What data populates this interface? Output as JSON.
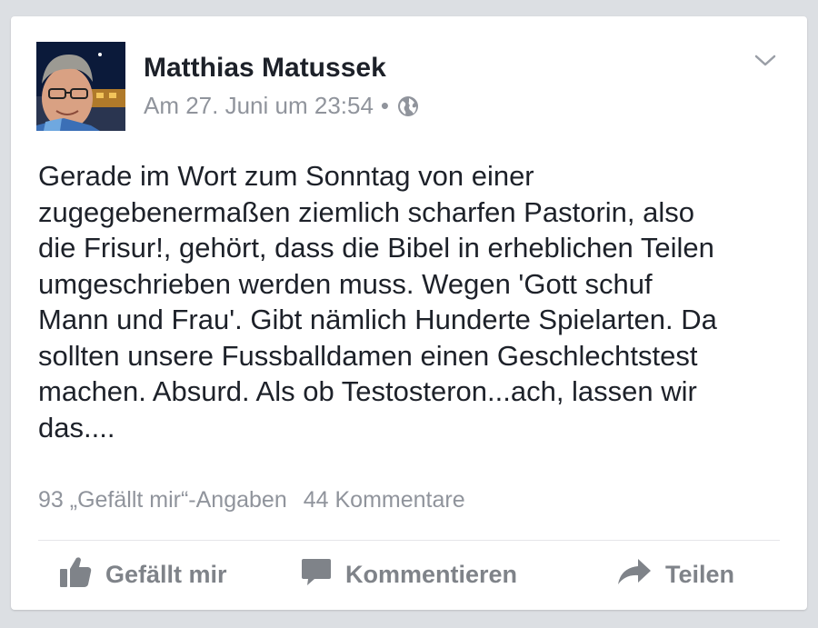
{
  "post": {
    "author": "Matthias Matussek",
    "timestamp": "Am 27. Juni um 23:54",
    "separator": "•",
    "privacy_icon": "globe-icon",
    "menu_icon": "chevron-down-icon",
    "text": "Gerade im Wort zum Sonntag von einer\nzugegebenermaßen ziemlich scharfen Pastorin, also\ndie Frisur!, gehört, dass die Bibel in erheblichen Teilen\numgeschrieben werden muss. Wegen 'Gott schuf\nMann und Frau'. Gibt nämlich Hunderte Spielarten. Da\nsollten unsere Fussballdamen einen Geschlechtstest\nmachen. Absurd. Als ob Testosteron...ach, lassen wir\ndas...."
  },
  "stats": {
    "likes": "93 „Gefällt mir“-Angaben",
    "comments": "44 Kommentare"
  },
  "actions": {
    "like_label": "Gefällt mir",
    "comment_label": "Kommentieren",
    "share_label": "Teilen"
  },
  "colors": {
    "text": "#1d2129",
    "secondary": "#90949c",
    "action": "#7f8389",
    "background": "#dcdfe3"
  }
}
